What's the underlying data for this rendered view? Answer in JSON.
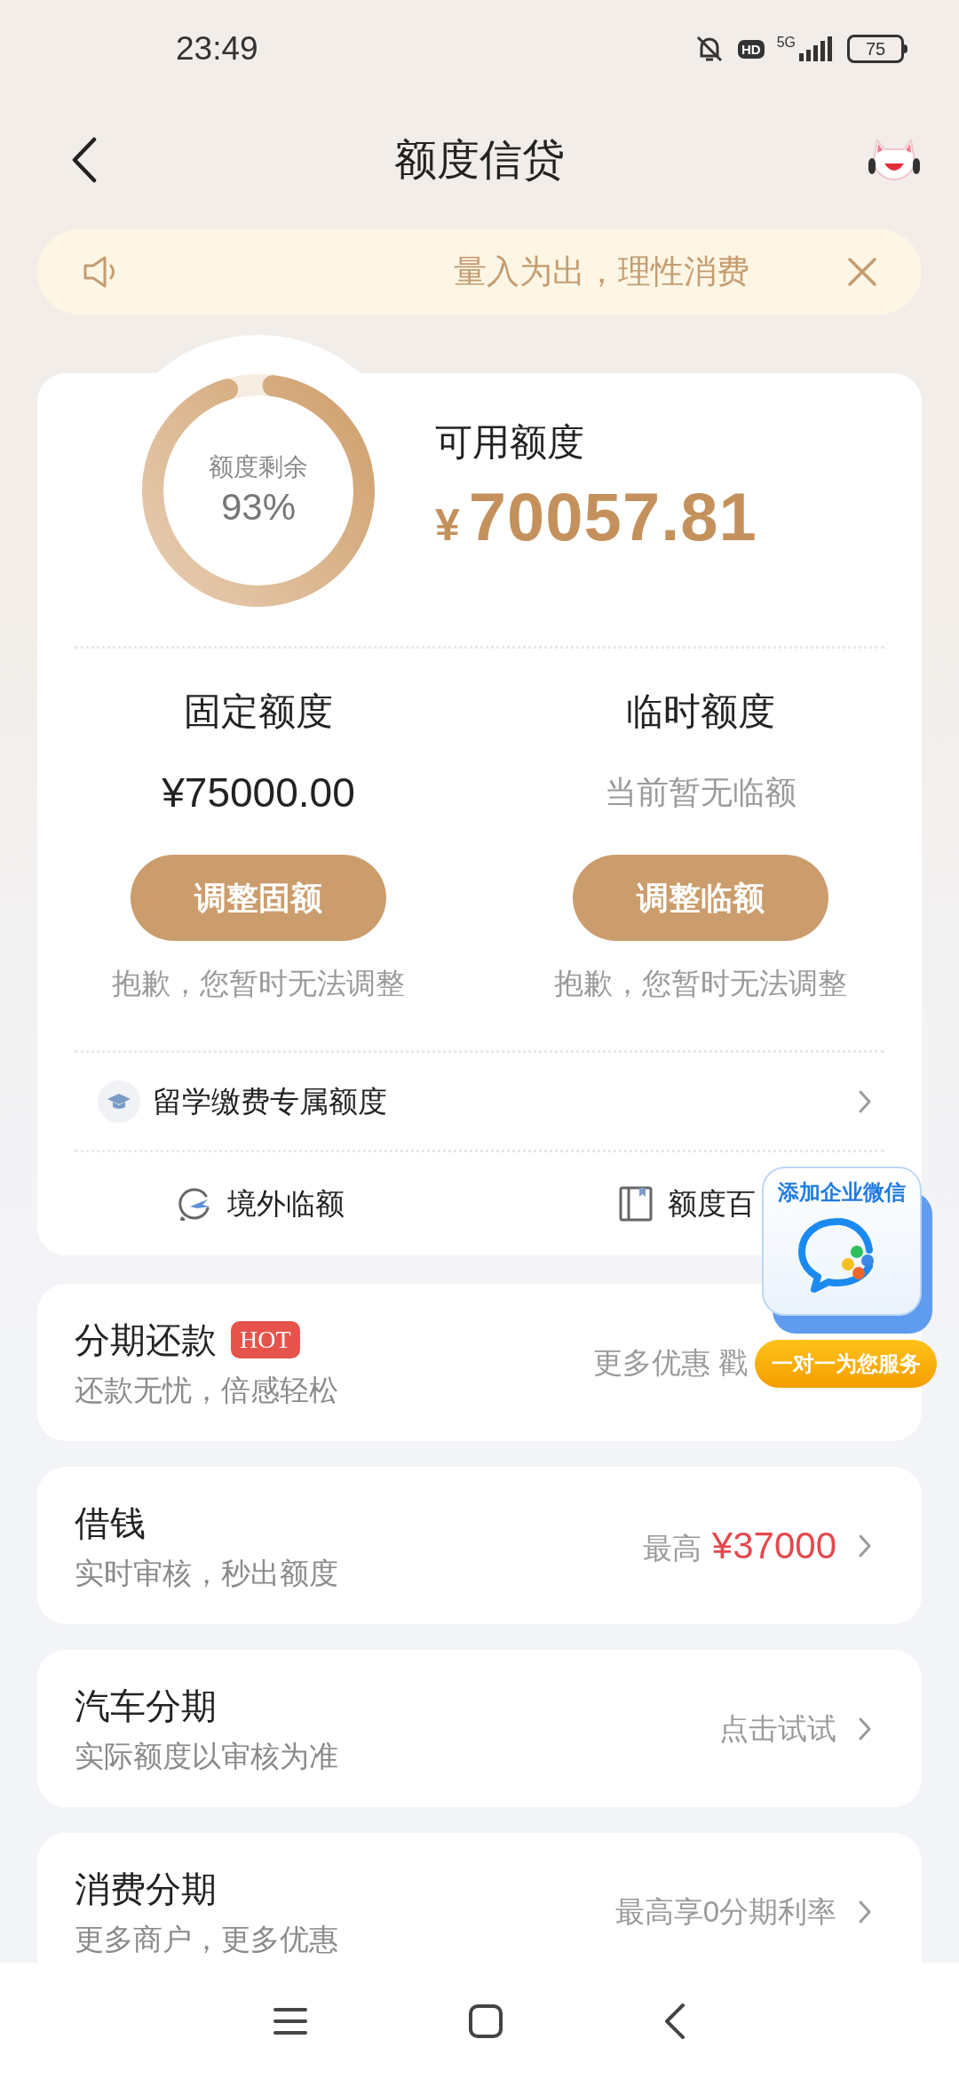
{
  "status_bar": {
    "time": "23:49",
    "hd": "HD",
    "network": "5G",
    "battery": "75"
  },
  "header": {
    "title": "额度信贷"
  },
  "notice": {
    "text": "量入为出，理性消费"
  },
  "quota": {
    "ring": {
      "label": "额度剩余",
      "value": "93%"
    },
    "available": {
      "label": "可用额度",
      "currency": "¥",
      "amount": "70057.81"
    },
    "columns": [
      {
        "title": "固定额度",
        "value": "¥75000.00",
        "kind": "amount",
        "button": "调整固额",
        "note": "抱歉，您暂时无法调整"
      },
      {
        "title": "临时额度",
        "value": "当前暂无临额",
        "kind": "empty",
        "button": "调整临额",
        "note": "抱歉，您暂时无法调整"
      }
    ],
    "study_row": {
      "label": "留学缴费专属额度"
    },
    "links": [
      {
        "label": "境外临额",
        "kind": "plane"
      },
      {
        "label": "额度百",
        "kind": "book"
      }
    ]
  },
  "products": [
    {
      "title": "分期还款",
      "badge": "HOT",
      "subtitle": "还款无忧，倍感轻松",
      "note": "更多优惠 戳",
      "chevron": false
    },
    {
      "title": "借钱",
      "subtitle": "实时审核，秒出额度",
      "note": "最高",
      "highlight": "¥37000",
      "chevron": true
    },
    {
      "title": "汽车分期",
      "subtitle": "实际额度以审核为准",
      "note": "点击试试",
      "chevron": true
    },
    {
      "title": "消费分期",
      "subtitle": "更多商户，更多优惠",
      "note": "最高享0分期利率",
      "chevron": true
    }
  ],
  "wecom_widget": {
    "title": "添加企业微信",
    "caption": "一对一为您服务"
  }
}
